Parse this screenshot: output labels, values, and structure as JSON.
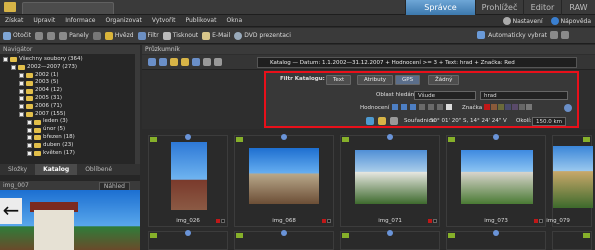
{
  "modes": {
    "active": "Správce",
    "prohlizec": "Prohlížeč",
    "editor": "Editor",
    "raw": "RAW"
  },
  "menu": [
    "Získat",
    "Upravit",
    "Informace",
    "Organizovat",
    "Vytvořit",
    "Publikovat",
    "Okna"
  ],
  "menu_right": {
    "settings": "Nastavení",
    "help": "Nápověda"
  },
  "toolbar": {
    "open": "Otočit",
    "panels": "Panely",
    "stars": "Hvězd",
    "filter": "Filtr",
    "print": "Tisknout",
    "email": "E-Mail",
    "dvd": "DVD prezentaci",
    "autoselect": "Automaticky vybrat"
  },
  "navigator": {
    "title": "Navigátor",
    "items": [
      {
        "label": "Všechny soubory (364)",
        "indent": 0
      },
      {
        "label": "2002—2007 (273)",
        "indent": 1
      },
      {
        "label": "2002 (1)",
        "indent": 2
      },
      {
        "label": "2003 (5)",
        "indent": 2
      },
      {
        "label": "2004 (12)",
        "indent": 2
      },
      {
        "label": "2005 (31)",
        "indent": 2
      },
      {
        "label": "2006 (71)",
        "indent": 2
      },
      {
        "label": "2007 (155)",
        "indent": 2
      },
      {
        "label": "leden (3)",
        "indent": 3
      },
      {
        "label": "únor (5)",
        "indent": 3
      },
      {
        "label": "březen (18)",
        "indent": 3
      },
      {
        "label": "duben (23)",
        "indent": 3
      },
      {
        "label": "květen (17)",
        "indent": 3
      }
    ]
  },
  "left_tabs": [
    "Složky",
    "Katalog",
    "Oblíbené"
  ],
  "preview": {
    "file": "img_007",
    "mode": "Náhled"
  },
  "content_title": "Průzkumník",
  "path": "Katalog — Datum: 1.1.2002—31.12.2007 + Hodnocení >= 3 + Text: hrad + Značka: Red",
  "filter": {
    "label": "Filtr Katalogu:",
    "buttons": [
      "Text",
      "Atributy",
      "GPS",
      "Žádný"
    ],
    "active_button": "GPS",
    "search_area_label": "Oblast hledání",
    "search_area_value": "Všude",
    "search_text": "hrad",
    "rating_label": "Hodnocení",
    "tag_label": "Značka",
    "coords_label": "Souřadnice:",
    "coords_value": "50° 01' 20\" S, 14° 24' 24\" V",
    "radius_label": "Okolí:",
    "radius_value": "150.0 km"
  },
  "thumbnails": [
    {
      "caption": "img_026"
    },
    {
      "caption": "img_068"
    },
    {
      "caption": "img_071"
    },
    {
      "caption": "img_073"
    },
    {
      "caption": "img_079"
    }
  ],
  "colors": {
    "accent": "#4a86c0",
    "highlight_box": "#e8101a",
    "tag_red": "#c01818"
  }
}
